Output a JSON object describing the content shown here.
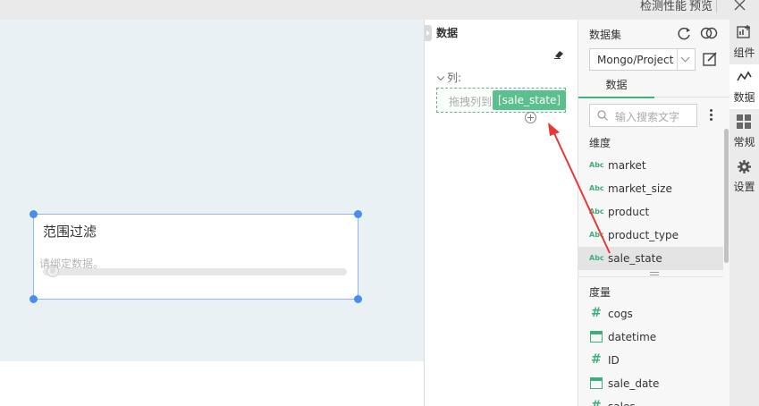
{
  "topbar": {
    "detect_label": "检测性能",
    "preview_label": "预览"
  },
  "canvas": {
    "widget": {
      "title": "范围过滤",
      "hint": "请绑定数据。",
      "slider_value": 0
    }
  },
  "data_panel": {
    "title": "数据",
    "column_label": "列:",
    "drop_placeholder": "拖拽列到",
    "dragged_chip": "[sale_state]"
  },
  "dataset_panel": {
    "title": "数据集",
    "selected_dataset": "Mongo/Project",
    "tab": "数据",
    "search_placeholder": "输入搜索文字",
    "dimensions_header": "维度",
    "dimensions": [
      {
        "name": "market",
        "icon": "abc-icon"
      },
      {
        "name": "market_size",
        "icon": "abc-icon"
      },
      {
        "name": "product",
        "icon": "abc-icon"
      },
      {
        "name": "product_type",
        "icon": "abc-icon"
      },
      {
        "name": "sale_state",
        "icon": "abc-icon",
        "selected": true
      }
    ],
    "measures_header": "度量",
    "measures": [
      {
        "name": "cogs",
        "icon": "hash-icon"
      },
      {
        "name": "datetime",
        "icon": "calendar-icon"
      },
      {
        "name": "ID",
        "icon": "hash-icon"
      },
      {
        "name": "sale_date",
        "icon": "calendar-icon"
      },
      {
        "name": "sales",
        "icon": "hash-icon"
      }
    ],
    "abc_text": "Abc"
  },
  "right_bar": {
    "items": [
      {
        "label": "组件",
        "icon": "component-icon"
      },
      {
        "label": "数据",
        "icon": "data-icon",
        "active": true
      },
      {
        "label": "常规",
        "icon": "grid-icon"
      },
      {
        "label": "设置",
        "icon": "gear-icon"
      }
    ]
  },
  "colors": {
    "accent": "#3fae7b",
    "annotation_arrow": "#e53935",
    "widget_border": "#8fb6f0"
  }
}
